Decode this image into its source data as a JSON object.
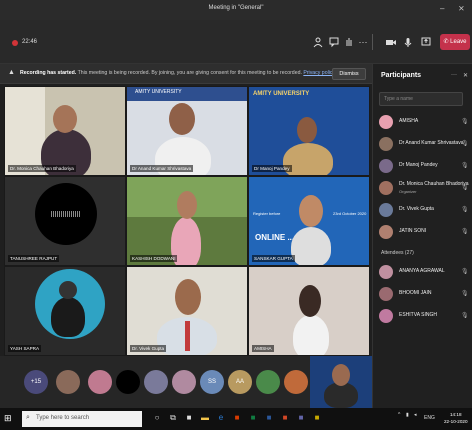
{
  "window": {
    "title": "Meeting in \"General\"",
    "min_glyph": "–",
    "close_glyph": "⨯"
  },
  "toolbar": {
    "timer": "22:46",
    "leave_label": "Leave",
    "more_glyph": "···"
  },
  "banner": {
    "bold": "Recording has started.",
    "text": " This meeting is being recorded. By joining, you are giving consent for this meeting to be recorded. ",
    "link": "Privacy policy",
    "dismiss_label": "Dismiss"
  },
  "tiles": [
    {
      "name": "Dr. Monica Chauhan Bhadoriya"
    },
    {
      "name": "Dr Anand Kumar Shrivastava"
    },
    {
      "name": "Dr Manoj Pandey"
    },
    {
      "name": "TANUSHREE RAJPUT"
    },
    {
      "name": "KASHISH DODWANI"
    },
    {
      "name": "SANSKAR GUPTA"
    },
    {
      "name": "YASH SAPRA"
    },
    {
      "name": "Dr. Vivek Gupta"
    },
    {
      "name": "AMISHA"
    }
  ],
  "slide": {
    "university": "AMITY UNIVERSITY",
    "title": "ONLINE ... SOME",
    "register": "Register before",
    "date": "23rd October 2020"
  },
  "strip": {
    "overflow_label": "+15",
    "initials": [
      "SS",
      "AA"
    ]
  },
  "participants": {
    "title": "Participants",
    "search_placeholder": "Type a name",
    "attendees_label": "Attendees (27)",
    "organizer_label": "Organizer",
    "presenters": [
      {
        "name": "AMISHA",
        "color": "#e8a0b0"
      },
      {
        "name": "Dr Anand Kumar Shrivastava",
        "color": "#8a7060"
      },
      {
        "name": "Dr Manoj Pandey",
        "color": "#7a6a8a"
      },
      {
        "name": "Dr. Monica Chauhan Bhadoriya",
        "color": "#a07060",
        "role": "Organizer"
      },
      {
        "name": "Dr. Vivek Gupta",
        "color": "#6a7a9a"
      },
      {
        "name": "JATIN SONI",
        "color": "#b08070"
      }
    ],
    "attendees": [
      {
        "name": "ANANYA AGRAWAL",
        "color": "#c090a0"
      },
      {
        "name": "BHOOMI JAIN",
        "color": "#9a6a70"
      },
      {
        "name": "ESHITVA SINGH",
        "color": "#c07aa0"
      }
    ]
  },
  "taskbar": {
    "search_placeholder": "Type here to search",
    "lang": "ENG",
    "time": "14:18",
    "date": "22-10-2020"
  }
}
